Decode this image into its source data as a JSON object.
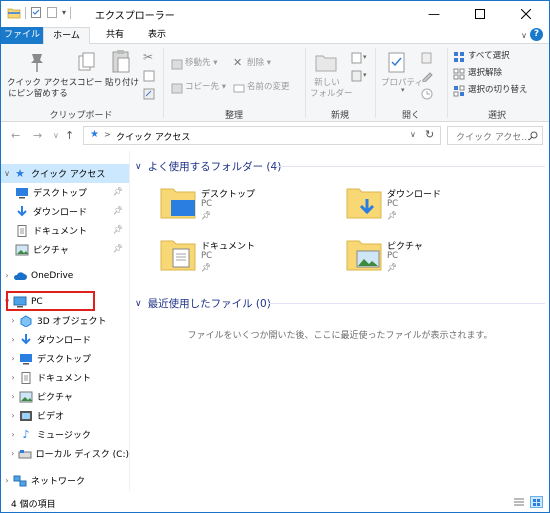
{
  "window": {
    "title": "エクスプローラー"
  },
  "ribbon_tabs": {
    "file": "ファイル",
    "home": "ホーム",
    "share": "共有",
    "view": "表示",
    "help": "?"
  },
  "ribbon": {
    "clipboard": {
      "pin": "クイック アクセス\nにピン留めする",
      "pin1": "クイック アクセス",
      "pin2": "にピン留めする",
      "copy": "コピー",
      "paste": "貼り付け",
      "label": "クリップボード"
    },
    "organize": {
      "move": "移動先",
      "delete": "削除",
      "copy_to": "コピー先",
      "rename": "名前の変更",
      "label": "整理"
    },
    "new": {
      "folder1": "新しい",
      "folder2": "フォルダー",
      "label": "新規"
    },
    "open": {
      "properties": "プロパティ",
      "label": "開く"
    },
    "select": {
      "all": "すべて選択",
      "none": "選択解除",
      "invert": "選択の切り替え",
      "label": "選択"
    }
  },
  "address": {
    "path": "クイック アクセス",
    "separator": ">",
    "search_placeholder": "クイック アクセ..."
  },
  "nav": {
    "quick_access": "クイック アクセス",
    "qa_items": [
      "デスクトップ",
      "ダウンロード",
      "ドキュメント",
      "ピクチャ"
    ],
    "onedrive": "OneDrive",
    "pc": "PC",
    "pc_items": [
      "3D オブジェクト",
      "ダウンロード",
      "デスクトップ",
      "ドキュメント",
      "ピクチャ",
      "ビデオ",
      "ミュージック",
      "ローカル ディスク (C:)"
    ],
    "network": "ネットワーク"
  },
  "content": {
    "frequent_header": "よく使用するフォルダー (4)",
    "folders": [
      {
        "name": "デスクトップ",
        "sub": "PC"
      },
      {
        "name": "ダウンロード",
        "sub": "PC"
      },
      {
        "name": "ドキュメント",
        "sub": "PC"
      },
      {
        "name": "ピクチャ",
        "sub": "PC"
      }
    ],
    "recent_header": "最近使用したファイル (0)",
    "recent_empty": "ファイルをいくつか開いた後、ここに最近使ったファイルが表示されます。"
  },
  "status": {
    "count": "4 個の項目"
  },
  "colors": {
    "accent": "#1979ca",
    "selected": "#cce8ff",
    "highlight": "#e0201b",
    "folder": "#f8d775"
  }
}
